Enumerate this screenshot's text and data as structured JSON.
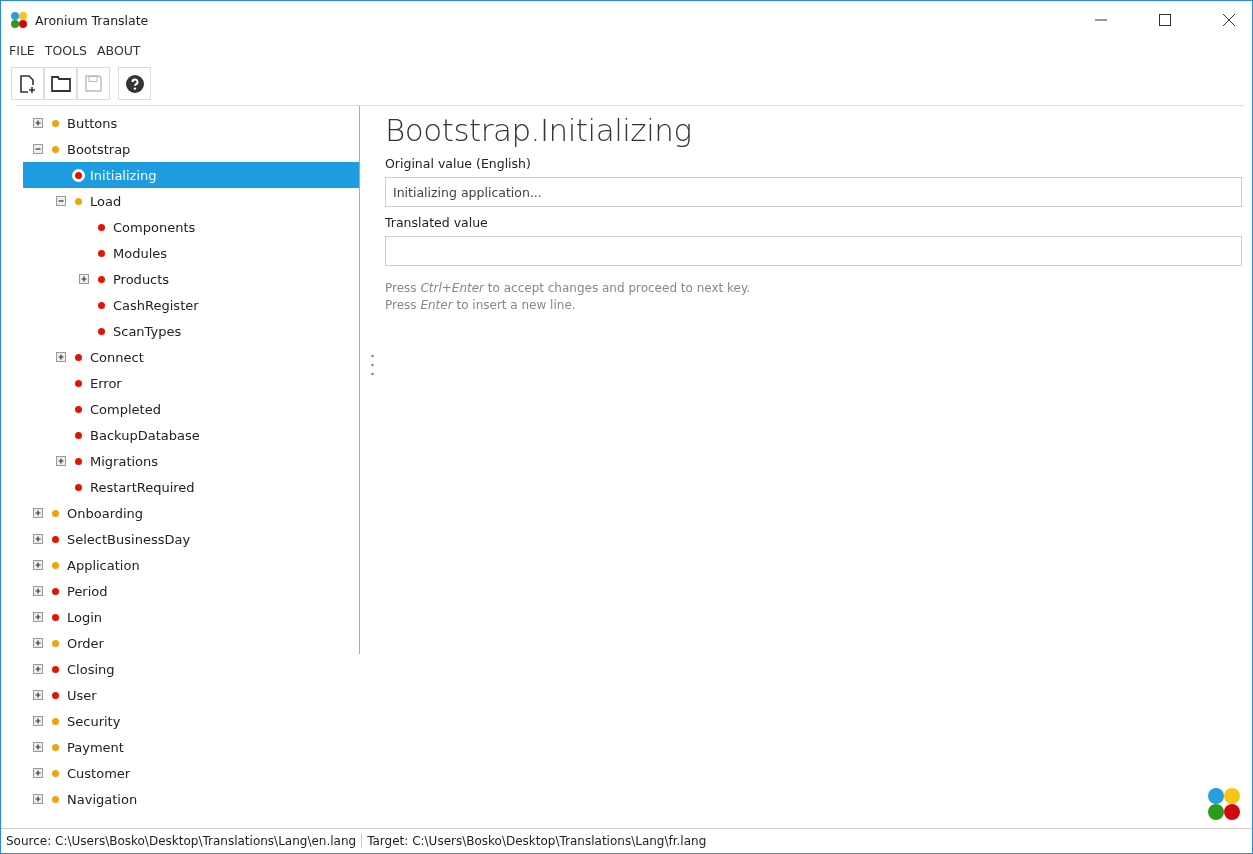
{
  "window": {
    "title": "Aronium Translate"
  },
  "menu": [
    "FILE",
    "TOOLS",
    "ABOUT"
  ],
  "toolbar": [
    {
      "kind": "new",
      "disabled": false
    },
    {
      "kind": "open",
      "disabled": false
    },
    {
      "kind": "save",
      "disabled": true
    },
    {
      "kind": "help",
      "disabled": false
    }
  ],
  "tree": [
    {
      "label": "Buttons",
      "color": "#f0a30a",
      "expanded": false,
      "selected": false
    },
    {
      "label": "Bootstrap",
      "color": "#f0a30a",
      "expanded": true,
      "selected": false,
      "children": [
        {
          "label": "Initializing",
          "color": "#e51400",
          "selected": true
        },
        {
          "label": "Load",
          "color": "#f0a30a",
          "expanded": true,
          "selected": false,
          "children": [
            {
              "label": "Components",
              "color": "#e51400",
              "selected": false
            },
            {
              "label": "Modules",
              "color": "#e51400",
              "selected": false
            },
            {
              "label": "Products",
              "color": "#e51400",
              "expanded": false,
              "selected": false
            },
            {
              "label": "CashRegister",
              "color": "#e51400",
              "selected": false
            },
            {
              "label": "ScanTypes",
              "color": "#e51400",
              "selected": false
            }
          ]
        },
        {
          "label": "Connect",
          "color": "#e51400",
          "expanded": false,
          "selected": false
        },
        {
          "label": "Error",
          "color": "#e51400",
          "selected": false
        },
        {
          "label": "Completed",
          "color": "#e51400",
          "selected": false
        },
        {
          "label": "BackupDatabase",
          "color": "#e51400",
          "selected": false
        },
        {
          "label": "Migrations",
          "color": "#e51400",
          "expanded": false,
          "selected": false
        },
        {
          "label": "RestartRequired",
          "color": "#e51400",
          "selected": false
        }
      ]
    },
    {
      "label": "Onboarding",
      "color": "#f0a30a",
      "expanded": false,
      "selected": false
    },
    {
      "label": "SelectBusinessDay",
      "color": "#e51400",
      "expanded": false,
      "selected": false
    },
    {
      "label": "Application",
      "color": "#f0a30a",
      "expanded": false,
      "selected": false
    },
    {
      "label": "Period",
      "color": "#e51400",
      "expanded": false,
      "selected": false
    },
    {
      "label": "Login",
      "color": "#e51400",
      "expanded": false,
      "selected": false
    },
    {
      "label": "Order",
      "color": "#f0a30a",
      "expanded": false,
      "selected": false
    },
    {
      "label": "Closing",
      "color": "#e51400",
      "expanded": false,
      "selected": false
    },
    {
      "label": "User",
      "color": "#e51400",
      "expanded": false,
      "selected": false
    },
    {
      "label": "Security",
      "color": "#f0a30a",
      "expanded": false,
      "selected": false
    },
    {
      "label": "Payment",
      "color": "#f0a30a",
      "expanded": false,
      "selected": false
    },
    {
      "label": "Customer",
      "color": "#f0a30a",
      "expanded": false,
      "selected": false
    },
    {
      "label": "Navigation",
      "color": "#f0a30a",
      "expanded": false,
      "selected": false
    }
  ],
  "editor": {
    "key": "Bootstrap.Initializing",
    "original_label": "Original value (English)",
    "original_value": "Initializing application...",
    "translated_label": "Translated value",
    "hints": [
      "Press *Ctrl+Enter* to accept changes and proceed to next key.",
      "Press *Enter* to insert a new line."
    ]
  },
  "status_bar": [
    "Source: C:\\Users\\Bosko\\Desktop\\Translations\\Lang\\en.lang",
    "Target: C:\\Users\\Bosko\\Desktop\\Translations\\Lang\\fr.lang"
  ]
}
